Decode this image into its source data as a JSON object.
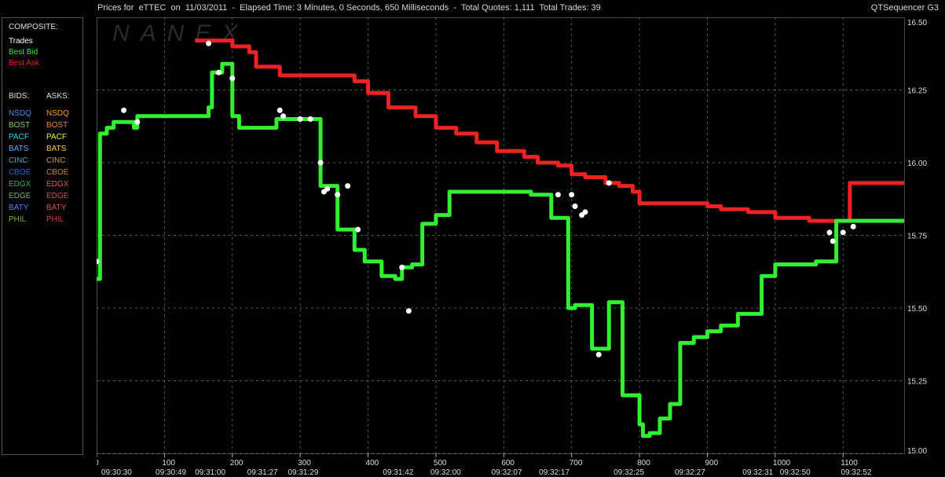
{
  "header": {
    "title": "Prices for  eTTEC  on  11/03/2011  -  Elapsed Time: 3 Minutes, 0 Seconds, 650 Milliseconds  -  Total Quotes: 1,111  Total Trades: 39",
    "app": "QTSequencer G3"
  },
  "watermark": "NANEX",
  "legend": {
    "composite_title": "COMPOSITE:",
    "composite": [
      {
        "label": "Trades",
        "color": "#ffffff"
      },
      {
        "label": "Best Bid",
        "color": "#33ee33"
      },
      {
        "label": "Best Ask",
        "color": "#ee2222"
      }
    ],
    "bids_title": "BIDS:",
    "asks_title": "ASKS:",
    "exchanges": [
      {
        "bid": "NSDQ",
        "ask": "NSDQ",
        "bid_color": "#4a90e0",
        "ask_color": "#ff9a40"
      },
      {
        "bid": "BOST",
        "ask": "BOST",
        "bid_color": "#88cc66",
        "ask_color": "#ee8844"
      },
      {
        "bid": "PACF",
        "ask": "PACF",
        "bid_color": "#22ddee",
        "ask_color": "#eeee44"
      },
      {
        "bid": "BATS",
        "ask": "BATS",
        "bid_color": "#66aaff",
        "ask_color": "#ffcc44"
      },
      {
        "bid": "CINC",
        "ask": "CINC",
        "bid_color": "#44aacc",
        "ask_color": "#cc9966"
      },
      {
        "bid": "CBOE",
        "ask": "CBOE",
        "bid_color": "#2266cc",
        "ask_color": "#cc8844"
      },
      {
        "bid": "EDGX",
        "ask": "EDGX",
        "bid_color": "#44aa66",
        "ask_color": "#cc6644"
      },
      {
        "bid": "EDGE",
        "ask": "EDGE",
        "bid_color": "#66bb55",
        "ask_color": "#cc5544"
      },
      {
        "bid": "BATY",
        "ask": "BATY",
        "bid_color": "#5588ee",
        "ask_color": "#dd5555"
      },
      {
        "bid": "PHIL",
        "ask": "PHIL",
        "bid_color": "#88aa44",
        "ask_color": "#cc4444"
      }
    ]
  },
  "chart_data": {
    "type": "line",
    "xlim": [
      0,
      1190
    ],
    "ylim": [
      15.0,
      16.5
    ],
    "grid": true,
    "y_ticks": [
      "15.00",
      "15.25",
      "15.50",
      "15.75",
      "16.00",
      "16.25",
      "16.50"
    ],
    "x_ticks": [
      0,
      100,
      200,
      300,
      400,
      500,
      600,
      700,
      800,
      900,
      1000,
      1100
    ],
    "time_labels": [
      {
        "x": 30,
        "label": "09:30:30"
      },
      {
        "x": 110,
        "label": "09:30:49"
      },
      {
        "x": 168,
        "label": "09:31:00"
      },
      {
        "x": 245,
        "label": "09:31:27"
      },
      {
        "x": 305,
        "label": "09:31:29"
      },
      {
        "x": 445,
        "label": "09:31:42"
      },
      {
        "x": 515,
        "label": "09:32:00"
      },
      {
        "x": 605,
        "label": "09:32:07"
      },
      {
        "x": 675,
        "label": "09:32:17"
      },
      {
        "x": 785,
        "label": "09:32:25"
      },
      {
        "x": 875,
        "label": "09:32:27"
      },
      {
        "x": 975,
        "label": "09:32:31"
      },
      {
        "x": 1030,
        "label": "09:32:50"
      },
      {
        "x": 1120,
        "label": "09:32:52"
      }
    ],
    "series": [
      {
        "name": "Best Ask",
        "color": "#ee2222",
        "x": [
          145,
          190,
          200,
          225,
          235,
          270,
          320,
          380,
          400,
          430,
          470,
          500,
          530,
          560,
          590,
          630,
          650,
          680,
          700,
          720,
          750,
          770,
          790,
          800,
          850,
          880,
          900,
          920,
          960,
          1000,
          1050,
          1090,
          1110,
          1190
        ],
        "y": [
          16.42,
          16.42,
          16.4,
          16.38,
          16.33,
          16.3,
          16.3,
          16.28,
          16.24,
          16.19,
          16.16,
          16.12,
          16.1,
          16.07,
          16.04,
          16.02,
          16.0,
          15.99,
          15.96,
          15.95,
          15.93,
          15.92,
          15.9,
          15.86,
          15.86,
          15.86,
          15.85,
          15.84,
          15.83,
          15.81,
          15.8,
          15.8,
          15.93,
          15.93
        ]
      },
      {
        "name": "Best Bid",
        "color": "#33ee33",
        "x": [
          0,
          5,
          15,
          25,
          35,
          55,
          60,
          110,
          150,
          165,
          170,
          185,
          200,
          210,
          255,
          265,
          275,
          300,
          330,
          355,
          360,
          380,
          395,
          420,
          440,
          450,
          465,
          480,
          500,
          520,
          540,
          570,
          600,
          640,
          650,
          670,
          695,
          705,
          730,
          745,
          755,
          775,
          800,
          805,
          815,
          830,
          845,
          860,
          880,
          900,
          920,
          945,
          980,
          985,
          1000,
          1040,
          1060,
          1090,
          1190
        ],
        "y": [
          15.6,
          16.1,
          16.12,
          16.14,
          16.14,
          16.12,
          16.16,
          16.16,
          16.16,
          16.19,
          16.31,
          16.34,
          16.16,
          16.12,
          16.12,
          16.15,
          16.15,
          16.15,
          15.92,
          15.77,
          15.77,
          15.7,
          15.66,
          15.61,
          15.6,
          15.64,
          15.65,
          15.79,
          15.82,
          15.9,
          15.9,
          15.9,
          15.9,
          15.89,
          15.89,
          15.81,
          15.5,
          15.51,
          15.36,
          15.36,
          15.52,
          15.2,
          15.1,
          15.06,
          15.07,
          15.12,
          15.17,
          15.38,
          15.4,
          15.42,
          15.44,
          15.48,
          15.61,
          15.61,
          15.65,
          15.65,
          15.66,
          15.8,
          15.8
        ]
      },
      {
        "name": "Trades",
        "color": "#ffffff",
        "x": [
          0,
          40,
          60,
          165,
          180,
          200,
          270,
          275,
          300,
          315,
          330,
          335,
          340,
          355,
          370,
          385,
          450,
          460,
          680,
          700,
          705,
          715,
          720,
          740,
          755,
          1080,
          1085,
          1100,
          1115
        ],
        "y": [
          15.66,
          16.18,
          16.14,
          16.41,
          16.31,
          16.29,
          16.18,
          16.16,
          16.15,
          16.15,
          16.0,
          15.9,
          15.91,
          15.89,
          15.92,
          15.77,
          15.64,
          15.49,
          15.89,
          15.89,
          15.85,
          15.82,
          15.83,
          15.34,
          15.93,
          15.76,
          15.73,
          15.76,
          15.78
        ]
      }
    ]
  }
}
